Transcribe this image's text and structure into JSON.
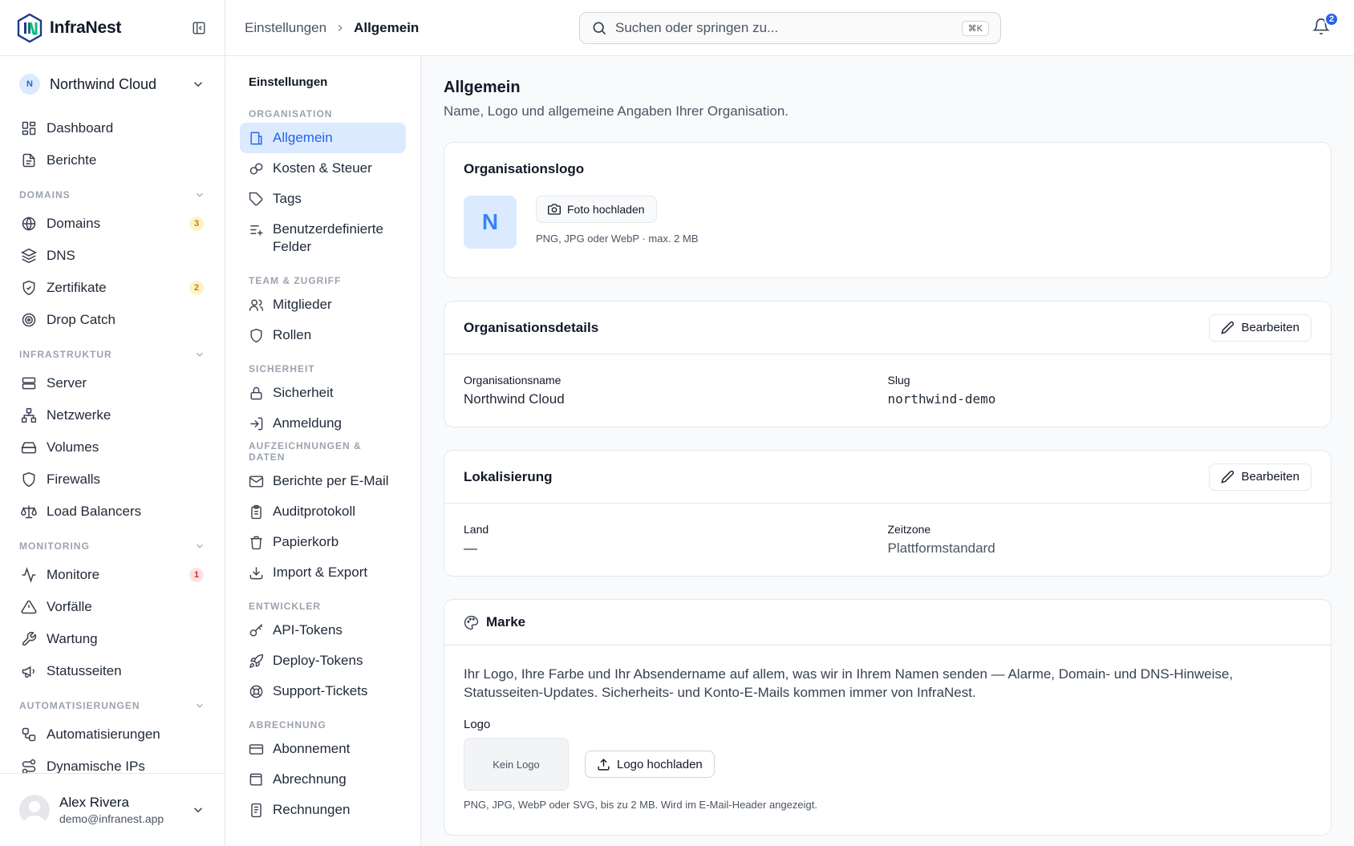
{
  "brand": {
    "name": "InfraNest"
  },
  "org": {
    "initial": "N",
    "name": "Northwind Cloud"
  },
  "sidebar": {
    "top": [
      {
        "label": "Dashboard",
        "icon": "dashboard-icon"
      },
      {
        "label": "Berichte",
        "icon": "report-icon"
      }
    ],
    "sections": [
      {
        "title": "Domains",
        "items": [
          {
            "label": "Domains",
            "icon": "globe-icon",
            "badge": "3",
            "badge_color": "#d97706"
          },
          {
            "label": "DNS",
            "icon": "layers-icon"
          },
          {
            "label": "Zertifikate",
            "icon": "shield-check-icon",
            "badge": "2",
            "badge_color": "#d97706"
          },
          {
            "label": "Drop Catch",
            "icon": "target-icon"
          }
        ]
      },
      {
        "title": "Infrastruktur",
        "items": [
          {
            "label": "Server",
            "icon": "server-icon"
          },
          {
            "label": "Netzwerke",
            "icon": "network-icon"
          },
          {
            "label": "Volumes",
            "icon": "drive-icon"
          },
          {
            "label": "Firewalls",
            "icon": "shield-icon"
          },
          {
            "label": "Load Balancers",
            "icon": "scale-icon"
          }
        ]
      },
      {
        "title": "Monitoring",
        "items": [
          {
            "label": "Monitore",
            "icon": "activity-icon",
            "badge": "1",
            "badge_color": "#dc2626"
          },
          {
            "label": "Vorfälle",
            "icon": "alert-triangle-icon"
          },
          {
            "label": "Wartung",
            "icon": "wrench-icon"
          },
          {
            "label": "Statusseiten",
            "icon": "megaphone-icon"
          }
        ]
      },
      {
        "title": "Automatisierungen",
        "items": [
          {
            "label": "Automatisierungen",
            "icon": "workflow-icon"
          },
          {
            "label": "Dynamische IPs",
            "icon": "route-icon"
          }
        ]
      }
    ]
  },
  "user": {
    "name": "Alex Rivera",
    "email": "demo@infranest.app"
  },
  "topbar": {
    "breadcrumb_parent": "Einstellungen",
    "breadcrumb_current": "Allgemein",
    "search_placeholder": "Suchen oder springen zu...",
    "search_shortcut": "⌘K",
    "notifications_count": "2"
  },
  "settings_nav": {
    "title": "Einstellungen",
    "sections": [
      {
        "title": "Organisation",
        "items": [
          {
            "label": "Allgemein",
            "icon": "building-icon",
            "active": true
          },
          {
            "label": "Kosten & Steuer",
            "icon": "coins-icon"
          },
          {
            "label": "Tags",
            "icon": "tag-icon"
          },
          {
            "label": "Benutzerdefinierte Felder",
            "icon": "list-plus-icon"
          }
        ]
      },
      {
        "title": "Team & Zugriff",
        "items": [
          {
            "label": "Mitglieder",
            "icon": "users-icon"
          },
          {
            "label": "Rollen",
            "icon": "shield-icon"
          }
        ]
      },
      {
        "title": "Sicherheit",
        "items": [
          {
            "label": "Sicherheit",
            "icon": "lock-icon"
          },
          {
            "label": "Anmeldung",
            "icon": "log-in-icon"
          }
        ]
      },
      {
        "title": "Aufzeichnungen & Daten",
        "items": [
          {
            "label": "Berichte per E-Mail",
            "icon": "mail-icon"
          },
          {
            "label": "Auditprotokoll",
            "icon": "clipboard-icon"
          },
          {
            "label": "Papierkorb",
            "icon": "trash-icon"
          },
          {
            "label": "Import & Export",
            "icon": "download-icon"
          }
        ]
      },
      {
        "title": "Entwickler",
        "items": [
          {
            "label": "API-Tokens",
            "icon": "key-icon"
          },
          {
            "label": "Deploy-Tokens",
            "icon": "rocket-icon"
          },
          {
            "label": "Support-Tickets",
            "icon": "lifebuoy-icon"
          }
        ]
      },
      {
        "title": "Abrechnung",
        "items": [
          {
            "label": "Abonnement",
            "icon": "credit-card-icon"
          },
          {
            "label": "Abrechnung",
            "icon": "wallet-icon"
          },
          {
            "label": "Rechnungen",
            "icon": "receipt-icon"
          }
        ]
      }
    ]
  },
  "page": {
    "title": "Allgemein",
    "subtitle": "Name, Logo und allgemeine Angaben Ihrer Organisation."
  },
  "logo_card": {
    "title": "Organisationslogo",
    "initial": "N",
    "upload_label": "Foto hochladen",
    "hint": "PNG, JPG oder WebP · max. 2 MB"
  },
  "details_card": {
    "title": "Organisationsdetails",
    "edit_label": "Bearbeiten",
    "name_label": "Organisationsname",
    "name_value": "Northwind Cloud",
    "slug_label": "Slug",
    "slug_value": "northwind-demo"
  },
  "locale_card": {
    "title": "Lokalisierung",
    "edit_label": "Bearbeiten",
    "country_label": "Land",
    "country_value": "—",
    "timezone_label": "Zeitzone",
    "timezone_value": "Plattformstandard"
  },
  "brand_card": {
    "title": "Marke",
    "description": "Ihr Logo, Ihre Farbe und Ihr Absendername auf allem, was wir in Ihrem Namen senden — Alarme, Domain- und DNS-Hinweise, Statusseiten-Updates. Sicherheits- und Konto-E-Mails kommen immer von InfraNest.",
    "logo_label": "Logo",
    "no_logo": "Kein Logo",
    "upload_label": "Logo hochladen",
    "hint": "PNG, JPG, WebP oder SVG, bis zu 2 MB. Wird im E-Mail-Header angezeigt."
  },
  "colors": {
    "accent": "#2563eb",
    "accent_bg": "#dbeafe",
    "border": "#e5e7eb"
  }
}
